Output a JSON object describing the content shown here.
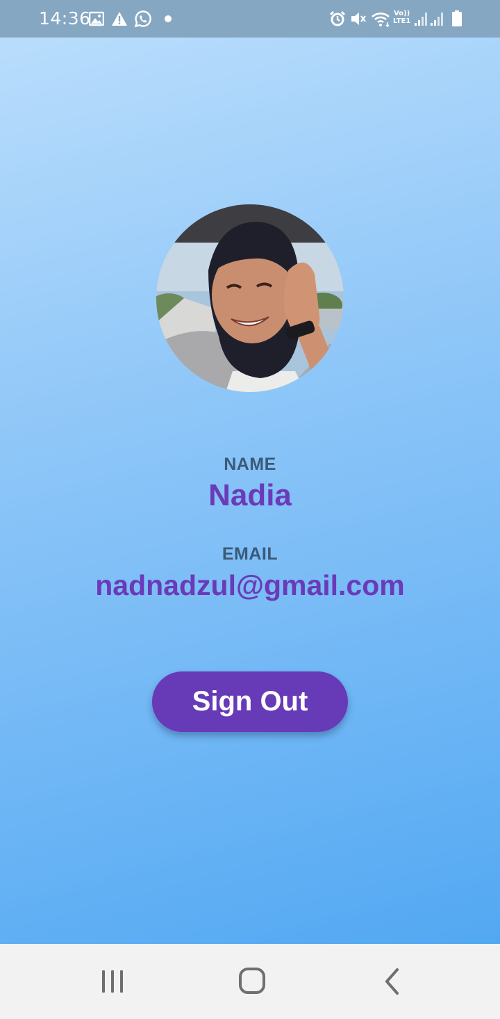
{
  "status_bar": {
    "time": "14:36",
    "icons": [
      "gallery-icon",
      "warning-icon",
      "whatsapp-icon",
      "dot-icon",
      "alarm-icon",
      "mute-icon",
      "wifi-icon",
      "volte-icon",
      "signal-icon",
      "signal-icon",
      "battery-icon"
    ],
    "volte_top": "Vo))",
    "volte_bottom": "LTE1"
  },
  "profile": {
    "avatar_icon": "profile-photo",
    "name_label": "NAME",
    "name_value": "Nadia",
    "email_label": "EMAIL",
    "email_value": "nadnadzul@gmail.com"
  },
  "actions": {
    "sign_out_label": "Sign Out"
  },
  "nav_bar": {
    "icons": [
      "recents-icon",
      "home-icon",
      "back-icon"
    ]
  },
  "colors": {
    "accent": "#673ab7",
    "value_text": "#6a3ab8",
    "label_text": "#3a5a78",
    "gradient_top": "#b9ddfc",
    "gradient_bottom": "#52a8f2"
  }
}
